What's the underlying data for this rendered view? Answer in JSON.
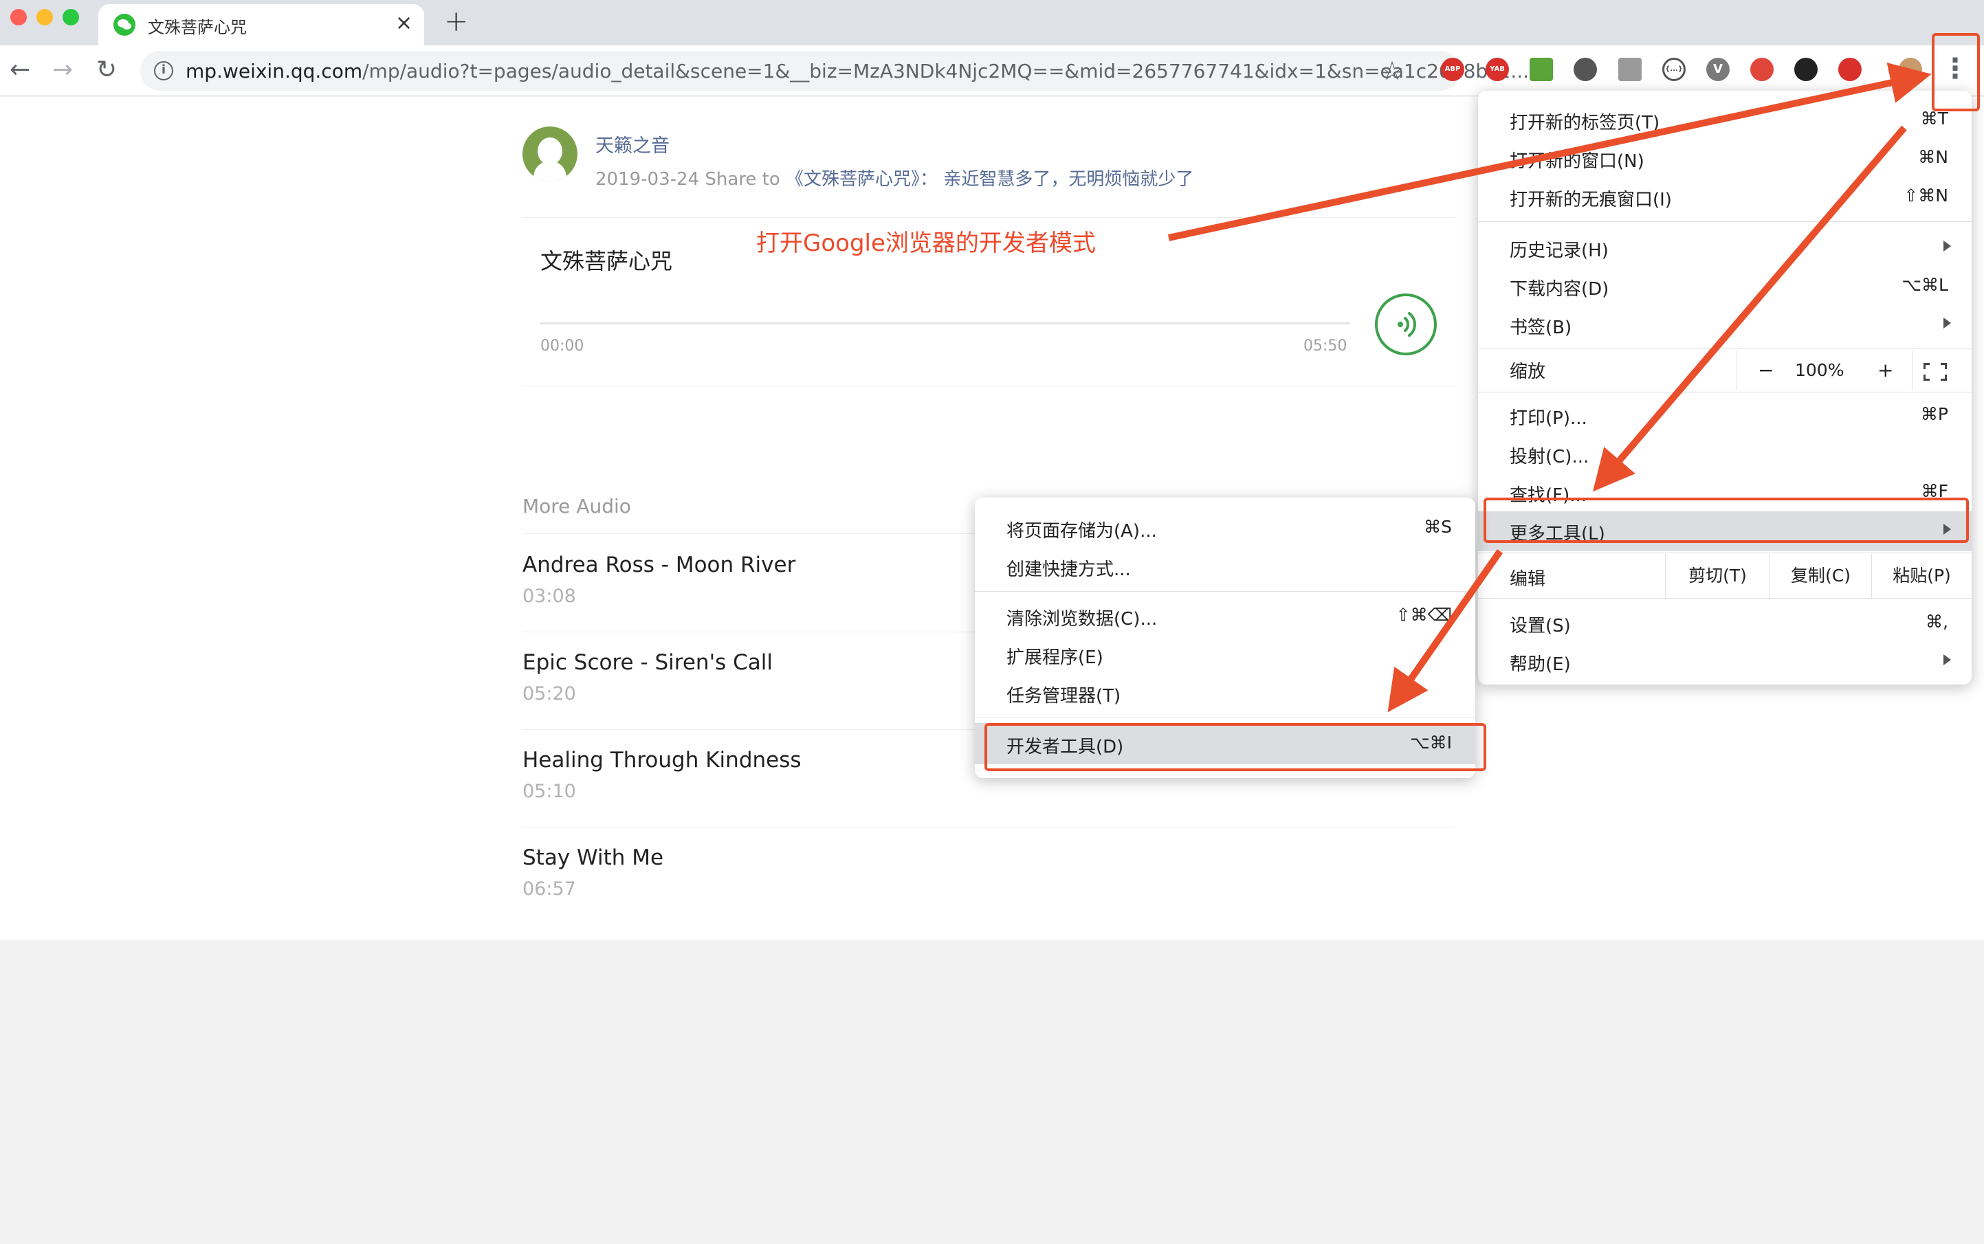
{
  "tab": {
    "title": "文殊菩萨心咒",
    "close": "×",
    "new_tab": "+"
  },
  "toolbar": {
    "back": "←",
    "forward": "→",
    "reload": "↻",
    "url_host": "mp.weixin.qq.com",
    "url_path": "/mp/audio?t=pages/audio_detail&scene=1&__biz=MzA3NDk4Njc2MQ==&mid=2657767741&idx=1&sn=ea1c2028bc2...",
    "extensions": [
      {
        "label": "ABP",
        "color": "#d9302b"
      },
      {
        "label": "YAB",
        "color": "#d9302b"
      },
      {
        "label": "",
        "color": "#5aa43a"
      },
      {
        "label": "",
        "color": "#555555"
      },
      {
        "label": "",
        "color": "#9a9a9a"
      },
      {
        "label": "{...}",
        "color": "#ffffff"
      },
      {
        "label": "V",
        "color": "#7a7a7a"
      },
      {
        "label": "",
        "color": "#e0473a"
      },
      {
        "label": "",
        "color": "#222222"
      },
      {
        "label": "",
        "color": "#d9302b"
      }
    ]
  },
  "article": {
    "account": "天籁之音",
    "date": "2019-03-24",
    "share_to": "Share to",
    "share_title": "《文殊菩萨心咒》：",
    "share_desc": "亲近智慧多了，无明烦恼就少了",
    "audio": {
      "title": "文殊菩萨心咒",
      "current": "00:00",
      "duration": "05:50",
      "progress": 0
    },
    "more_audio_label": "More Audio",
    "more_audio": [
      {
        "name": "Andrea Ross - Moon River",
        "duration": "03:08"
      },
      {
        "name": "Epic Score - Siren's Call",
        "duration": "05:20"
      },
      {
        "name": "Healing Through Kindness",
        "duration": "05:10"
      },
      {
        "name": "Stay With Me",
        "duration": "06:57"
      }
    ]
  },
  "annotation": {
    "text": "打开Google浏览器的开发者模式",
    "color": "#ed4a2b"
  },
  "main_menu": {
    "new_tab": {
      "label": "打开新的标签页(T)",
      "shortcut": "⌘T"
    },
    "new_window": {
      "label": "打开新的窗口(N)",
      "shortcut": "⌘N"
    },
    "incognito": {
      "label": "打开新的无痕窗口(I)",
      "shortcut": "⇧⌘N"
    },
    "history": {
      "label": "历史记录(H)"
    },
    "downloads": {
      "label": "下载内容(D)",
      "shortcut": "⌥⌘L"
    },
    "bookmarks": {
      "label": "书签(B)"
    },
    "zoom": {
      "label": "缩放",
      "minus": "−",
      "value": "100%",
      "plus": "+"
    },
    "print": {
      "label": "打印(P)...",
      "shortcut": "⌘P"
    },
    "cast": {
      "label": "投射(C)..."
    },
    "find": {
      "label": "查找(F)...",
      "shortcut": "⌘F"
    },
    "more_tools": {
      "label": "更多工具(L)"
    },
    "edit": {
      "label": "编辑",
      "cut": "剪切(T)",
      "copy": "复制(C)",
      "paste": "粘贴(P)"
    },
    "settings": {
      "label": "设置(S)",
      "shortcut": "⌘,"
    },
    "help": {
      "label": "帮助(E)"
    }
  },
  "sub_menu": {
    "save_page": {
      "label": "将页面存储为(A)...",
      "shortcut": "⌘S"
    },
    "create_shortcut": {
      "label": "创建快捷方式..."
    },
    "clear_data": {
      "label": "清除浏览数据(C)...",
      "shortcut": "⇧⌘⌫"
    },
    "extensions": {
      "label": "扩展程序(E)"
    },
    "task_manager": {
      "label": "任务管理器(T)"
    },
    "dev_tools": {
      "label": "开发者工具(D)",
      "shortcut": "⌥⌘I"
    }
  }
}
